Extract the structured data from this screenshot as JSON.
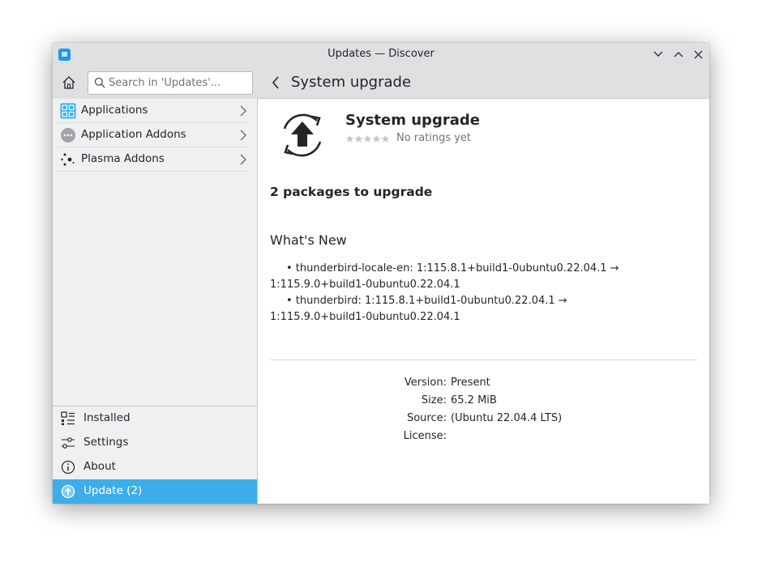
{
  "window": {
    "title": "Updates — Discover"
  },
  "search": {
    "placeholder": "Search in 'Updates'..."
  },
  "page_header": {
    "title": "System upgrade"
  },
  "categories": [
    {
      "label": "Applications",
      "icon": "applications-grid-icon"
    },
    {
      "label": "Application Addons",
      "icon": "more-dots-icon"
    },
    {
      "label": "Plasma Addons",
      "icon": "plasma-icon"
    }
  ],
  "bottom_nav": [
    {
      "label": "Installed",
      "icon": "installed-list-icon"
    },
    {
      "label": "Settings",
      "icon": "settings-sliders-icon"
    },
    {
      "label": "About",
      "icon": "info-icon"
    },
    {
      "label": "Update (2)",
      "icon": "update-icon",
      "active": true
    }
  ],
  "app": {
    "title": "System upgrade",
    "rating_stars": 0,
    "rating_text": "No ratings yet",
    "packages_summary": "2 packages to upgrade",
    "whats_new_heading": "What's New",
    "changes": [
      {
        "line1": "• thunderbird-locale-en: 1:115.8.1+build1-0ubuntu0.22.04.1 →",
        "line2": "1:115.9.0+build1-0ubuntu0.22.04.1"
      },
      {
        "line1": "• thunderbird: 1:115.8.1+build1-0ubuntu0.22.04.1 →",
        "line2": "1:115.9.0+build1-0ubuntu0.22.04.1"
      }
    ],
    "details": [
      {
        "key": "Version:",
        "value": "Present"
      },
      {
        "key": "Size:",
        "value": "65.2 MiB"
      },
      {
        "key": "Source:",
        "value": " (Ubuntu 22.04.4 LTS)"
      },
      {
        "key": "License:",
        "value": ""
      }
    ]
  },
  "colors": {
    "accent": "#3daee9",
    "titlebar": "#dee0e2",
    "sidebar": "#eff0f1",
    "brand_blue": "#1d99f3"
  }
}
